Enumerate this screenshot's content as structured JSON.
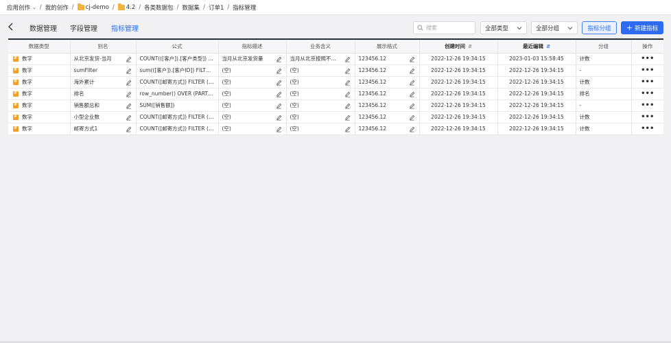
{
  "breadcrumb": {
    "items": [
      "应用创作",
      "我的创作",
      "cj-demo",
      "4.2",
      "各类数据包",
      "数据集",
      "订单1",
      "指标管理"
    ]
  },
  "tabs": [
    "数据管理",
    "字段管理",
    "指标管理"
  ],
  "active_tab": "指标管理",
  "search": {
    "placeholder": "搜索"
  },
  "filters": {
    "type": "全部类型",
    "group": "全部分组"
  },
  "buttons": {
    "group": "指标分组",
    "new": "新建指标",
    "new_icon": "+"
  },
  "columns": [
    "数据类型",
    "别名",
    "公式",
    "指标描述",
    "业务含义",
    "展示格式",
    "创建时间",
    "最近编辑",
    "分组",
    "操作"
  ],
  "sort_icon": "⇵",
  "more_icon": "•••",
  "rows": [
    [
      "数字",
      "从北京发货-当月",
      "COUNT(([客户]).[客户类型]) FILTER ...",
      "当月从北京发货量",
      "当月从北京按照不同...",
      "123456.12",
      "2022-12-26 19:34:15",
      "2023-01-03 15:58:45",
      "计数"
    ],
    [
      "数字",
      "sumFilter",
      "sum(([客户]).[客户ID]) FILTER (WHE...",
      "(空)",
      "(空)",
      "123456.12",
      "2022-12-26 19:34:15",
      "2022-12-26 19:34:15",
      "-"
    ],
    [
      "数字",
      "海外累计",
      "COUNT([邮寄方式]) FILTER (WHERE...",
      "(空)",
      "(空)",
      "123456.12",
      "2022-12-26 19:34:15",
      "2022-12-26 19:34:15",
      "计数"
    ],
    [
      "数字",
      "排名",
      "row_number() OVER (PARTITION B...",
      "(空)",
      "(空)",
      "123456.12",
      "2022-12-26 19:34:15",
      "2022-12-26 19:34:15",
      "排名"
    ],
    [
      "数字",
      "销售额总和",
      "SUM([销售额])",
      "(空)",
      "(空)",
      "123456.12",
      "2022-12-26 19:34:15",
      "2022-12-26 19:34:15",
      "-"
    ],
    [
      "数字",
      "小型企业数",
      "COUNT([邮寄方式]) FILTER (WHERE...",
      "(空)",
      "(空)",
      "123456.12",
      "2022-12-26 19:34:15",
      "2022-12-26 19:34:15",
      "计数"
    ],
    [
      "数字",
      "邮寄方式1",
      "COUNT([邮寄方式]) FILTER (WHERE...",
      "(空)",
      "(空)",
      "123456.12",
      "2022-12-26 19:34:15",
      "2022-12-26 19:34:15",
      "计数"
    ]
  ],
  "colors": {
    "accent": "#2d6cf0",
    "type_icon": "#f0a02b",
    "folder": "#f3b43b"
  }
}
